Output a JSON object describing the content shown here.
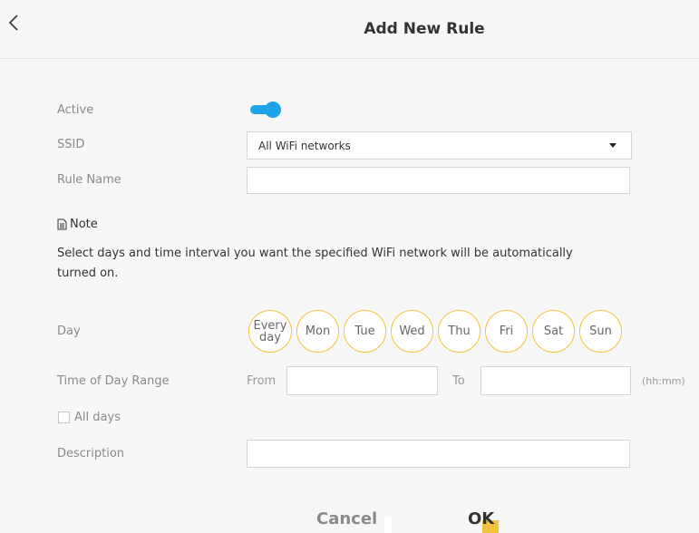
{
  "header": {
    "title": "Add New Rule"
  },
  "form": {
    "active_label": "Active",
    "active_on": true,
    "ssid_label": "SSID",
    "ssid_value": "All WiFi networks",
    "rule_name_label": "Rule Name",
    "rule_name_value": "",
    "note_heading": "Note",
    "note_text": "Select days and time interval you want the specified WiFi network will be automatically turned on.",
    "day_label": "Day",
    "days": [
      "Every day",
      "Mon",
      "Tue",
      "Wed",
      "Thu",
      "Fri",
      "Sat",
      "Sun"
    ],
    "time_range_label": "Time of Day Range",
    "from_label": "From",
    "from_value": "",
    "to_label": "To",
    "to_value": "",
    "time_format": "(hh:mm)",
    "all_days_label": "All days",
    "all_days_checked": false,
    "description_label": "Description",
    "description_value": ""
  },
  "buttons": {
    "cancel": "Cancel",
    "ok": "OK"
  },
  "colors": {
    "accent_blue": "#1fa3e8",
    "day_ring": "#f0c43c"
  }
}
